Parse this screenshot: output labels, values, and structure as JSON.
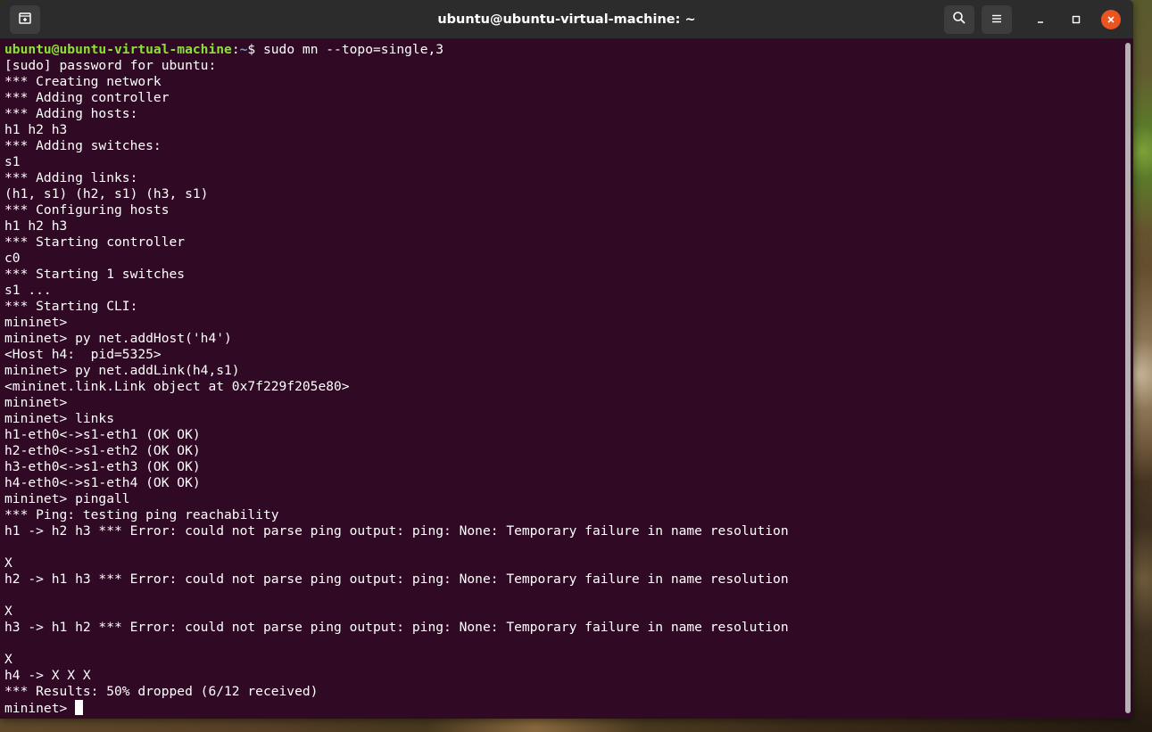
{
  "window": {
    "title": "ubuntu@ubuntu-virtual-machine: ~"
  },
  "icons": {
    "new_tab": "new-tab-icon",
    "search": "search-icon",
    "menu": "hamburger-menu-icon",
    "minimize": "minimize-icon",
    "maximize": "maximize-icon",
    "close": "close-icon"
  },
  "colors": {
    "terminal_bg": "#300a24",
    "prompt_user": "#8ae234",
    "prompt_path": "#729fcf",
    "close_button": "#e95420"
  },
  "terminal": {
    "prompt_user": "ubuntu@ubuntu-virtual-machine",
    "prompt_sep": ":",
    "prompt_path": "~",
    "prompt_symbol": "$ ",
    "first_command": "sudo mn --topo=single,3",
    "lines": [
      "[sudo] password for ubuntu:",
      "*** Creating network",
      "*** Adding controller",
      "*** Adding hosts:",
      "h1 h2 h3",
      "*** Adding switches:",
      "s1",
      "*** Adding links:",
      "(h1, s1) (h2, s1) (h3, s1)",
      "*** Configuring hosts",
      "h1 h2 h3",
      "*** Starting controller",
      "c0",
      "*** Starting 1 switches",
      "s1 ...",
      "*** Starting CLI:",
      "mininet>",
      "mininet> py net.addHost('h4')",
      "<Host h4:  pid=5325>",
      "mininet> py net.addLink(h4,s1)",
      "<mininet.link.Link object at 0x7f229f205e80>",
      "mininet>",
      "mininet> links",
      "h1-eth0<->s1-eth1 (OK OK)",
      "h2-eth0<->s1-eth2 (OK OK)",
      "h3-eth0<->s1-eth3 (OK OK)",
      "h4-eth0<->s1-eth4 (OK OK)",
      "mininet> pingall",
      "*** Ping: testing ping reachability",
      "h1 -> h2 h3 *** Error: could not parse ping output: ping: None: Temporary failure in name resolution",
      "",
      "X",
      "h2 -> h1 h3 *** Error: could not parse ping output: ping: None: Temporary failure in name resolution",
      "",
      "X",
      "h3 -> h1 h2 *** Error: could not parse ping output: ping: None: Temporary failure in name resolution",
      "",
      "X",
      "h4 -> X X X",
      "*** Results: 50% dropped (6/12 received)"
    ],
    "current_prompt": "mininet> "
  }
}
